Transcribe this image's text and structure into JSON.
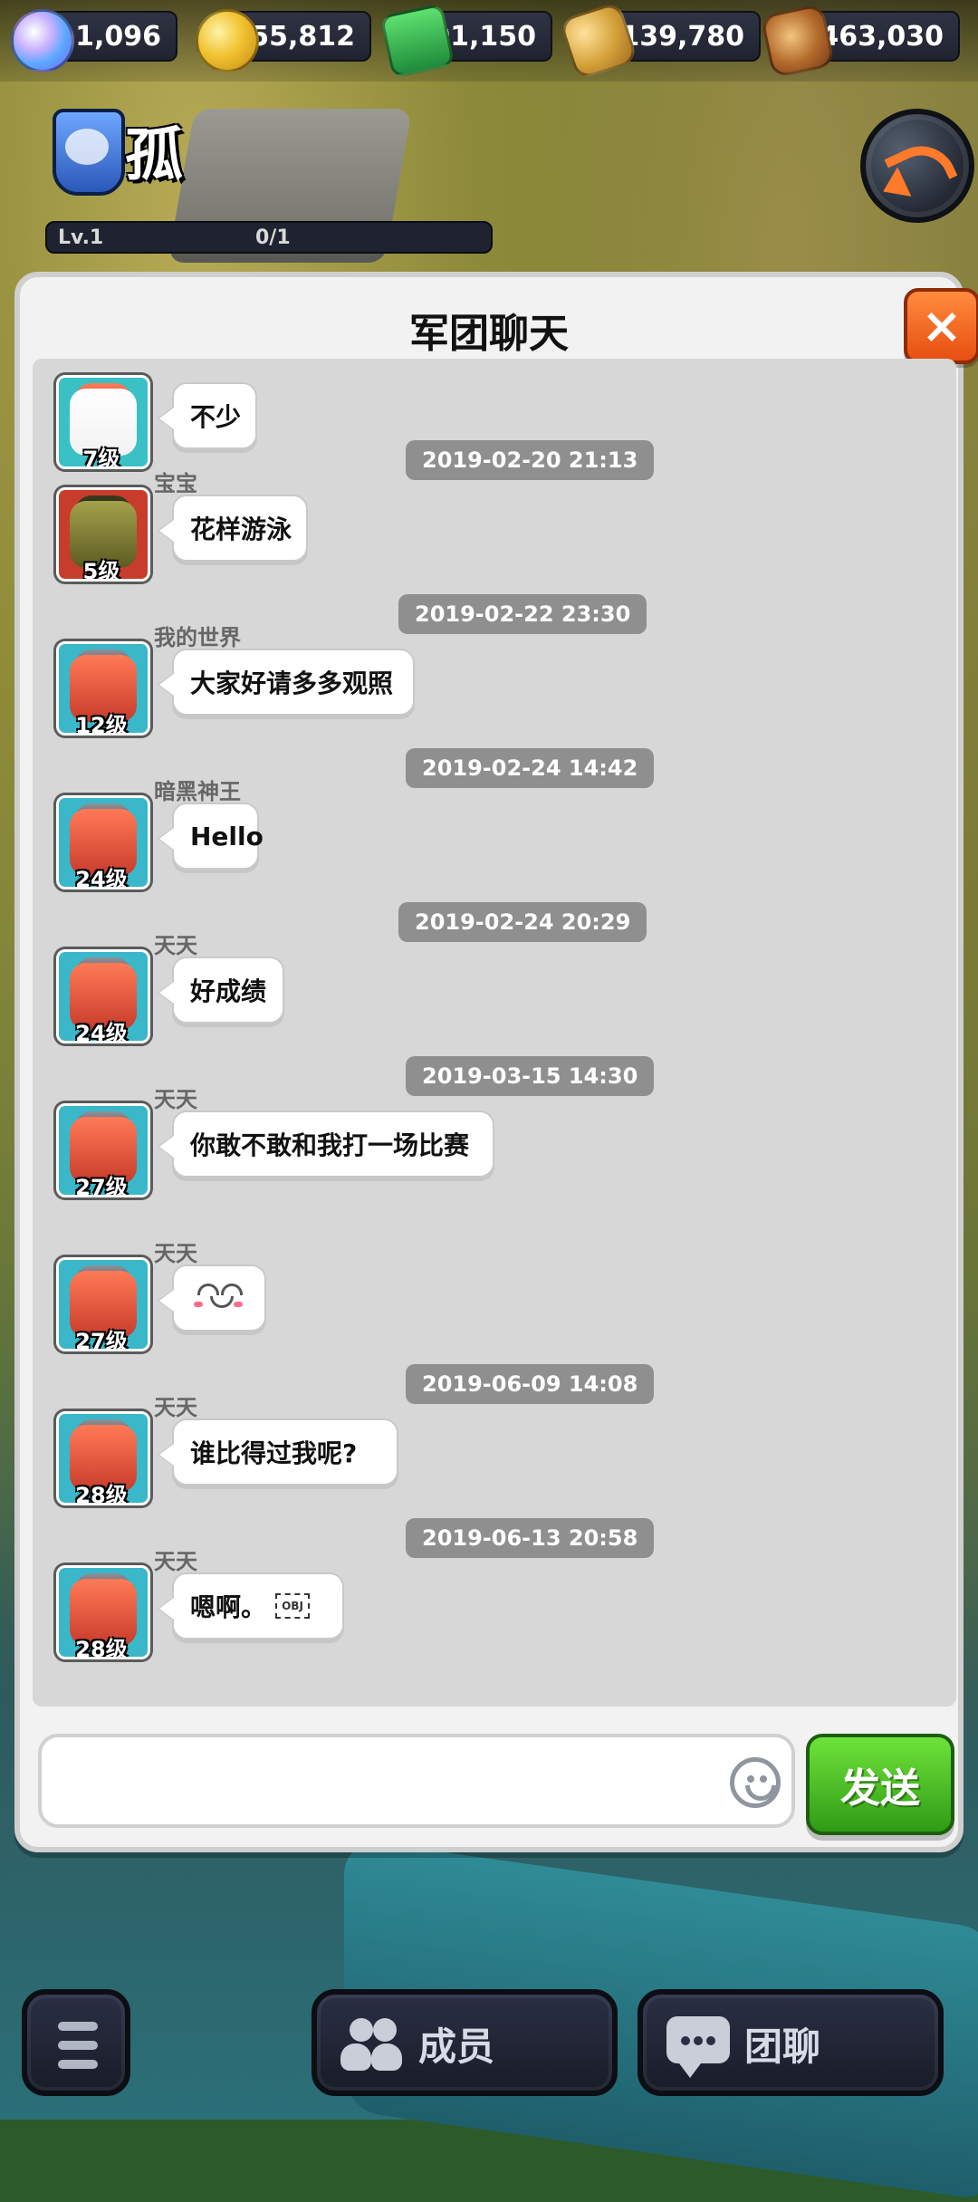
{
  "resources": [
    {
      "icon": "gem-icon",
      "value": "1,096"
    },
    {
      "icon": "coin-icon",
      "value": "1,155,812"
    },
    {
      "icon": "green-badge-icon",
      "value": "101,150"
    },
    {
      "icon": "wheat-icon",
      "value": "1,139,780"
    },
    {
      "icon": "wood-log-icon",
      "value": "4,463,030"
    }
  ],
  "guild": {
    "name": "孤",
    "level_label": "Lv.1",
    "progress_text": "0/1"
  },
  "chat": {
    "title": "军团聊天",
    "messages": [
      {
        "time": "",
        "name": "",
        "level": "7级",
        "text": "不少",
        "avatar": "old"
      },
      {
        "time": "2019-02-20 21:13",
        "name": "宝宝",
        "level": "5级",
        "text": "花样游泳",
        "avatar": "bb"
      },
      {
        "time": "2019-02-22 23:30",
        "name": "我的世界",
        "level": "12级",
        "text": "大家好请多多观照",
        "avatar": "red"
      },
      {
        "time": "2019-02-24 14:42",
        "name": "暗黑神王",
        "level": "24级",
        "text": "Hello",
        "avatar": "red"
      },
      {
        "time": "2019-02-24 20:29",
        "name": "天天",
        "level": "24级",
        "text": "好成绩",
        "avatar": "red"
      },
      {
        "time": "2019-03-15 14:30",
        "name": "天天",
        "level": "27级",
        "text": "你敢不敢和我打一场比赛",
        "avatar": "red"
      },
      {
        "time": "",
        "name": "天天",
        "level": "27级",
        "text": "",
        "avatar": "red",
        "emoji": "smiling-face-emoji"
      },
      {
        "time": "2019-06-09 14:08",
        "name": "天天",
        "level": "28级",
        "text": "谁比得过我呢?",
        "avatar": "red"
      },
      {
        "time": "2019-06-13 20:58",
        "name": "天天",
        "level": "28级",
        "text": "嗯啊。",
        "avatar": "red",
        "obj": "OBJ"
      }
    ],
    "input_placeholder": "",
    "send_label": "发送"
  },
  "bottom_nav": {
    "members_label": "成员",
    "guild_chat_label": "团聊"
  }
}
